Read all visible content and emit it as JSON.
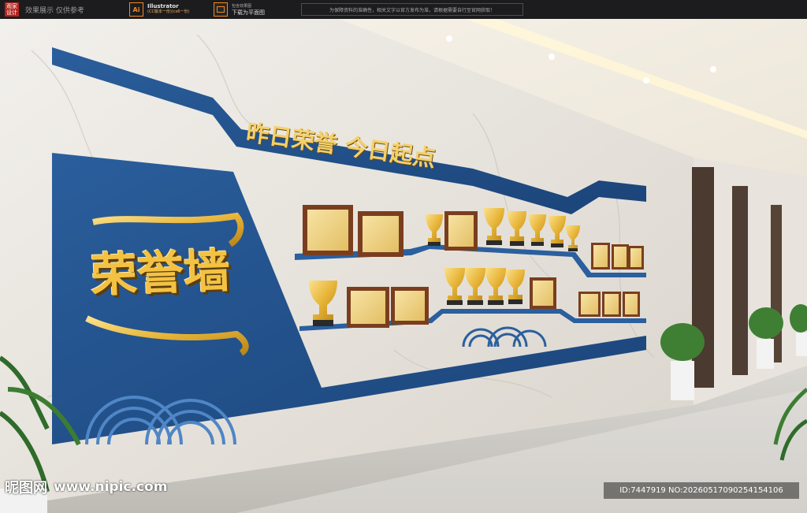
{
  "topbar": {
    "brand_chip": "观家\n设计",
    "brand_text": "效果展示 仅供参考",
    "ai_badge": "Ai",
    "ai_title": "Illustrator",
    "ai_subtitle": "(CC版本一份)(cs6一份)",
    "download_top": "包含效果图",
    "download_bottom": "下载为平面图",
    "notice": "为保障资料的准确性，相关文字以官方发布为准，请根据需要自行至官网获取！"
  },
  "scene": {
    "slogan": "昨日荣誉 今日起点",
    "wall_title": "荣誉墙"
  },
  "watermark": {
    "logo": "昵图网",
    "url": "www.nipic.com",
    "id_text": "ID:7447919 NO:20260517090254154106"
  },
  "colors": {
    "wall_blue": "#1f4f8a",
    "gold": "#f3c243",
    "marble": "#ece9e4"
  }
}
